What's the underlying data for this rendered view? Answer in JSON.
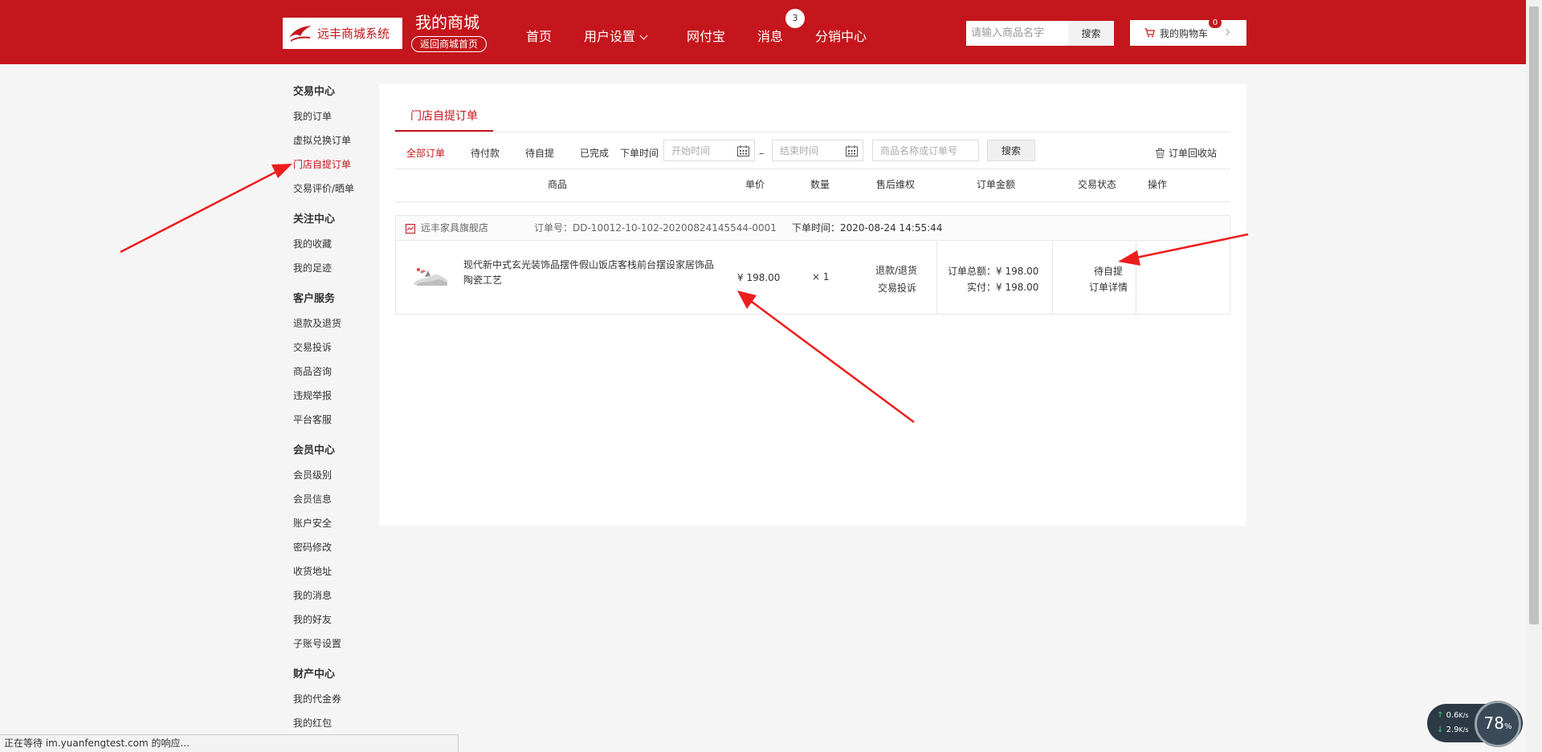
{
  "header": {
    "logo_text": "远丰商城系统",
    "site_title": "我的商城",
    "back_home": "返回商城首页",
    "nav": {
      "home": "首页",
      "user_settings": "用户设置",
      "wallet": "网付宝",
      "messages": "消息",
      "messages_badge": "3",
      "distribution": "分销中心"
    },
    "search_placeholder": "请输入商品名字",
    "search_button": "搜索",
    "cart_label": "我的购物车",
    "cart_count": "0"
  },
  "sidebar": {
    "groups": [
      {
        "title": "交易中心",
        "items": [
          "我的订单",
          "虚拟兑换订单",
          "门店自提订单",
          "交易评价/晒单"
        ]
      },
      {
        "title": "关注中心",
        "items": [
          "我的收藏",
          "我的足迹"
        ]
      },
      {
        "title": "客户服务",
        "items": [
          "退款及退货",
          "交易投诉",
          "商品咨询",
          "违规举报",
          "平台客服"
        ]
      },
      {
        "title": "会员中心",
        "items": [
          "会员级别",
          "会员信息",
          "账户安全",
          "密码修改",
          "收货地址",
          "我的消息",
          "我的好友",
          "子账号设置"
        ]
      },
      {
        "title": "财产中心",
        "items": [
          "我的代金券",
          "我的红包"
        ]
      }
    ]
  },
  "main": {
    "tab_label": "门店自提订单",
    "filters": [
      "全部订单",
      "待付款",
      "待自提",
      "已完成"
    ],
    "order_time_label": "下单时间",
    "start_placeholder": "开始时间",
    "end_placeholder": "结束时间",
    "range_dash": "–",
    "keyword_placeholder": "商品名称或订单号",
    "search_button": "搜索",
    "recycle_bin": "订单回收站",
    "columns": [
      "商品",
      "单价",
      "数量",
      "售后维权",
      "订单金额",
      "交易状态",
      "操作"
    ]
  },
  "order": {
    "shop_name": "远丰家具旗舰店",
    "order_no": "订单号：DD-10012-10-102-20200824145544-0001",
    "order_time": "下单时间：2020-08-24 14:55:44",
    "product_name": "现代新中式玄光装饰品摆件假山饭店客栈前台摆设家居饰品陶瓷工艺",
    "unit_price": "¥ 198.00",
    "quantity": "× 1",
    "refund": "退款/退货",
    "complaint": "交易投诉",
    "total": "订单总额：¥ 198.00",
    "paid": "实付：¥ 198.00",
    "status": "待自提",
    "detail": "订单详情"
  },
  "statusbar": {
    "text": "正在等待 im.yuanfengtest.com 的响应..."
  },
  "net_widget": {
    "up": "0.6",
    "down": "2.9",
    "unit": "K/s",
    "gauge": "78",
    "gauge_unit": "%"
  },
  "colors": {
    "brand": "#c4161c",
    "arrow": "#ee1d1d"
  }
}
